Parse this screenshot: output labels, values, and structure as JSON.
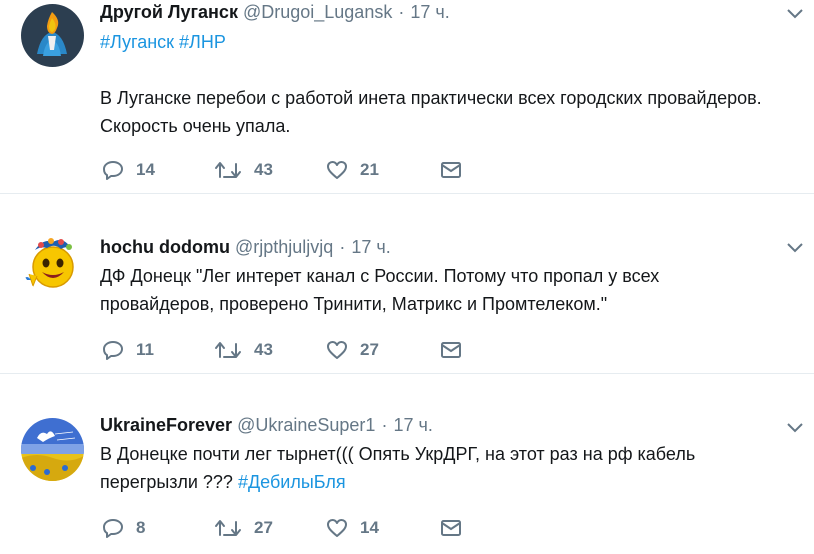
{
  "tweets": [
    {
      "name": "Другой Луганск",
      "handle": "@Drugoi_Lugansk",
      "time": "17 ч.",
      "hashtags": "#Луганск #ЛНР",
      "text": "В Луганске перебои с работой инета практически всех городских провайдеров. Скорость очень упала.",
      "replies": "14",
      "retweets": "43",
      "likes": "21"
    },
    {
      "name": "hochu dodomu",
      "handle": "@rjpthjuljvjq",
      "time": "17 ч.",
      "text": "ДФ Донецк \"Лег интерет канал с России. Потому что пропал у всех провайдеров, проверено Тринити, Матрикс и Промтелеком.\"",
      "replies": "11",
      "retweets": "43",
      "likes": "27"
    },
    {
      "name": "UkraineForever",
      "handle": "@UkraineSuper1",
      "time": "17 ч.",
      "text_before": "В Донецке почти лег тырнет((( Опять УкрДРГ, на этот раз на рф кабель перегрызли ???",
      "text_hashtag": "#ДебилыБля",
      "replies": "8",
      "retweets": "27",
      "likes": "14"
    }
  ],
  "dot": "·",
  "colors": {
    "text": "#14171a",
    "muted": "#657786",
    "link": "#1b95e0",
    "divider": "#e6ecf0"
  }
}
